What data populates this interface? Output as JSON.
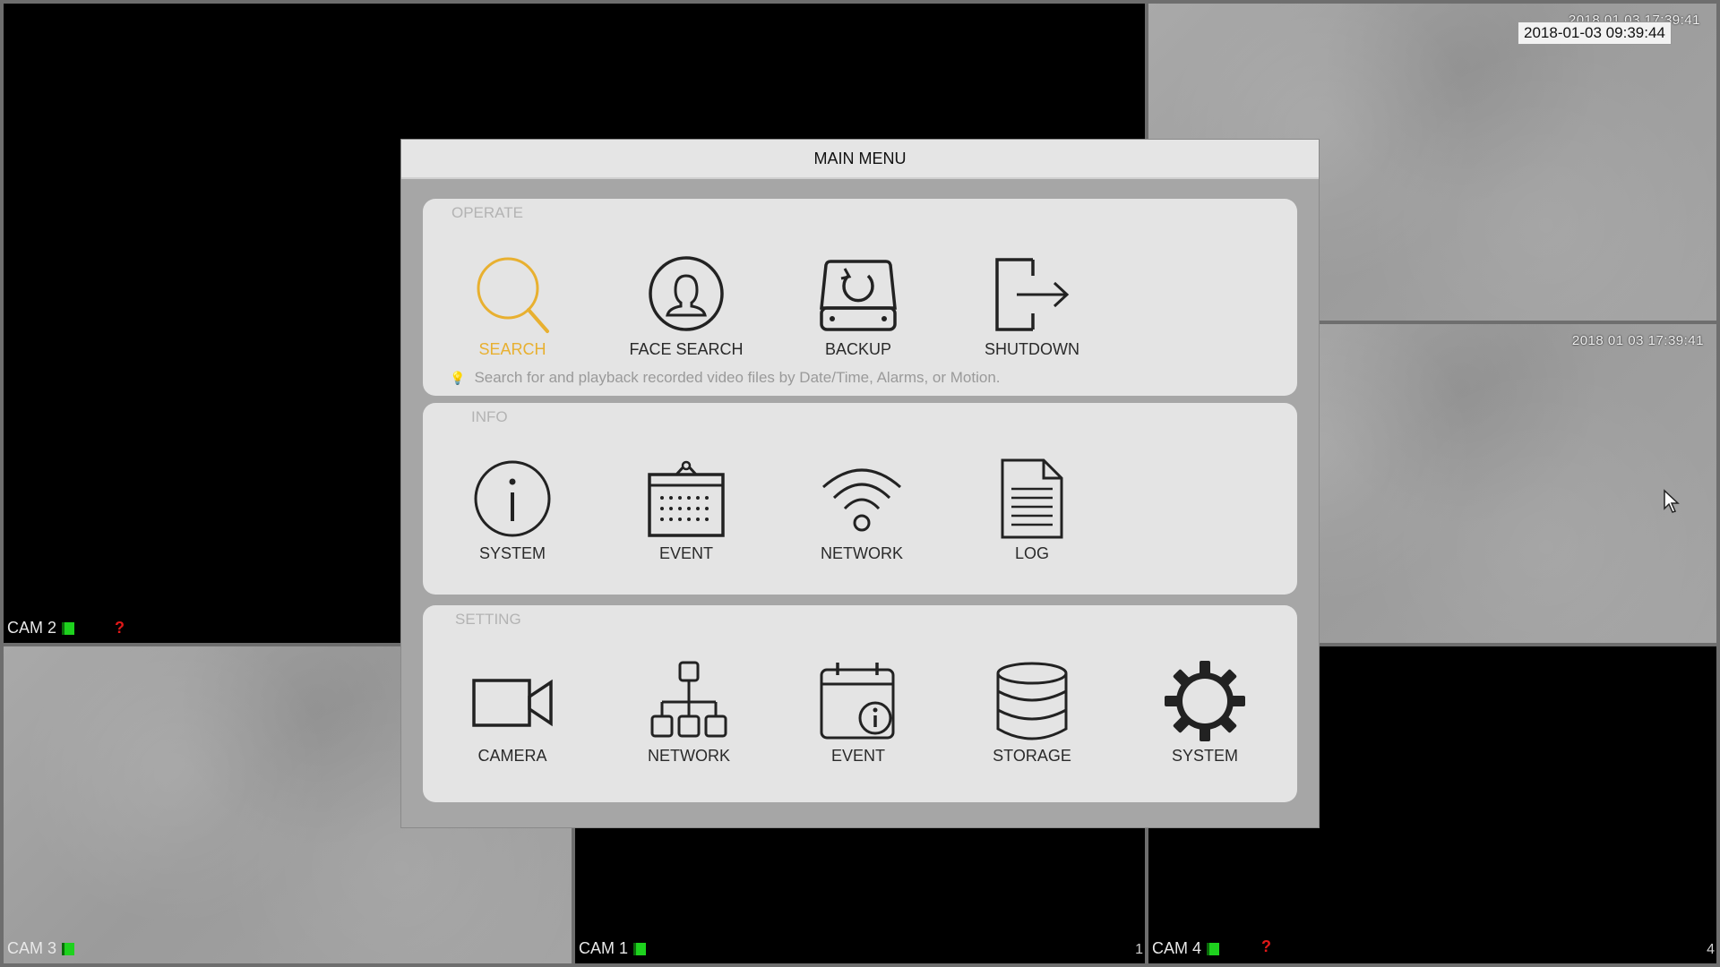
{
  "cameras": {
    "cam2": {
      "label": "CAM 2"
    },
    "cam3": {
      "label": "CAM 3"
    },
    "cam1": {
      "label": "CAM 1",
      "channel": "1"
    },
    "cam4": {
      "label": "CAM 4",
      "channel": "4"
    },
    "top_right": {
      "timestamp_box": "2018-01-03 09:39:44",
      "timestamp_faint": "2018 01 03 17:39:41"
    },
    "mid_right": {
      "timestamp": "2018 01 03 17:39:41"
    },
    "alert_symbol": "?"
  },
  "dialog": {
    "title": "MAIN MENU",
    "operate": {
      "title": "OPERATE",
      "items": [
        {
          "label": "SEARCH",
          "icon": "magnifier-icon",
          "selected": true
        },
        {
          "label": "FACE SEARCH",
          "icon": "face-icon"
        },
        {
          "label": "BACKUP",
          "icon": "backup-drive-icon"
        },
        {
          "label": "SHUTDOWN",
          "icon": "logout-icon"
        }
      ],
      "hint": "Search for and playback recorded video files by Date/Time, Alarms, or Motion."
    },
    "info": {
      "title": "INFO",
      "items": [
        {
          "label": "SYSTEM",
          "icon": "info-icon"
        },
        {
          "label": "EVENT",
          "icon": "event-board-icon"
        },
        {
          "label": "NETWORK",
          "icon": "wifi-icon"
        },
        {
          "label": "LOG",
          "icon": "document-icon"
        }
      ]
    },
    "setting": {
      "title": "SETTING",
      "items": [
        {
          "label": "CAMERA",
          "icon": "camera-icon"
        },
        {
          "label": "NETWORK",
          "icon": "network-tree-icon"
        },
        {
          "label": "EVENT",
          "icon": "calendar-info-icon"
        },
        {
          "label": "STORAGE",
          "icon": "database-icon"
        },
        {
          "label": "SYSTEM",
          "icon": "gear-icon"
        }
      ]
    }
  },
  "colors": {
    "selected": "#e8b030",
    "record": "#1ed21e",
    "alert": "#e01818"
  }
}
